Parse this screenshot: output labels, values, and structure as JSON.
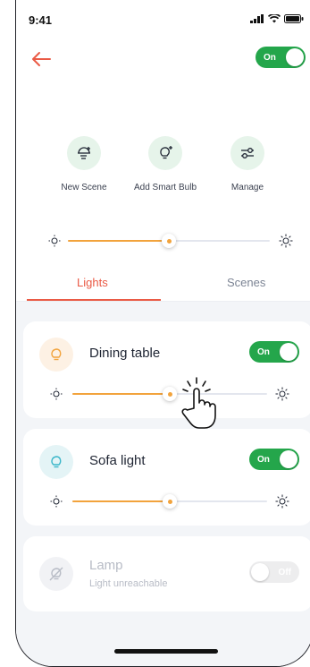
{
  "status_bar": {
    "time": "9:41"
  },
  "header": {
    "master_toggle": {
      "label": "On",
      "state": "on"
    }
  },
  "quick_actions": [
    {
      "label": "New Scene",
      "icon": "scene-bulb-add-icon"
    },
    {
      "label": "Add Smart Bulb",
      "icon": "bulb-add-icon"
    },
    {
      "label": "Manage",
      "icon": "sliders-icon"
    }
  ],
  "master_brightness": {
    "value": 0.5
  },
  "tabs": [
    {
      "label": "Lights",
      "active": true
    },
    {
      "label": "Scenes",
      "active": false
    }
  ],
  "devices": [
    {
      "name": "Dining table",
      "toggle_label": "On",
      "state": "on",
      "brightness": 0.5,
      "icon": "bulb-icon",
      "icon_color": "#f2a33c",
      "icon_bg": "#fdf1e4"
    },
    {
      "name": "Sofa light",
      "toggle_label": "On",
      "state": "on",
      "brightness": 0.5,
      "icon": "bulb-icon",
      "icon_color": "#3ab6c9",
      "icon_bg": "#e4f4f6"
    },
    {
      "name": "Lamp",
      "subtitle": "Light unreachable",
      "toggle_label": "Off",
      "state": "off",
      "icon": "bulb-off-icon",
      "icon_color": "#b8bcc6",
      "icon_bg": "#f1f2f5"
    }
  ],
  "colors": {
    "accent": "#ea5a45",
    "toggle_on": "#24a64b",
    "slider": "#f2a33c"
  }
}
